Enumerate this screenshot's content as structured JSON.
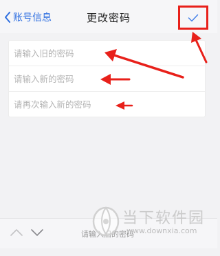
{
  "navbar": {
    "back_label": "账号信息",
    "title": "更改密码",
    "confirm_icon": "checkmark-icon"
  },
  "form": {
    "fields": [
      {
        "placeholder": "请输入旧的密码",
        "value": ""
      },
      {
        "placeholder": "请输入新的密码",
        "value": ""
      },
      {
        "placeholder": "请再次输入新的密码",
        "value": ""
      }
    ]
  },
  "keyboard_bar": {
    "text": "请输入旧的密码"
  },
  "watermark": {
    "logo": "downxia-logo",
    "name": "当下软件园",
    "url": "www.downxia.com"
  },
  "colors": {
    "accent": "#2f6fe0",
    "annotation": "#e8201a",
    "background": "#f2f2f4"
  }
}
